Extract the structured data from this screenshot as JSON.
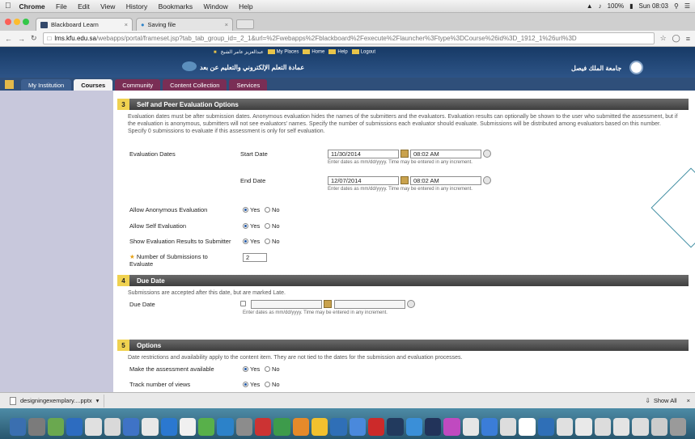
{
  "macos": {
    "app_name": "Chrome",
    "menus": [
      "File",
      "Edit",
      "View",
      "History",
      "Bookmarks",
      "Window",
      "Help"
    ],
    "battery": "100%",
    "clock": "Sun 08:03"
  },
  "browser": {
    "tabs": [
      {
        "label": "Blackboard Learn",
        "active": true
      },
      {
        "label": "Saving file",
        "active": false
      }
    ],
    "url_host": "lms.kfu.edu.sa",
    "url_path": "/webapps/portal/frameset.jsp?tab_tab_group_id=_2_1&url=%2Fwebapps%2Fblackboard%2Fexecute%2Flauncher%3Ftype%3DCourse%26id%3D_1912_1%26url%3D"
  },
  "bb": {
    "user_name": "عبدالعزيز عامر الشيخ",
    "top_links": [
      "My Places",
      "Home",
      "Help",
      "Logout"
    ],
    "deanship_title": "عمادة التعلم الإلكتروني والتعليم عن بعد",
    "university_title": "جامعة الملك فيصل",
    "nav_tabs": [
      {
        "label": "My Institution",
        "active": false
      },
      {
        "label": "Courses",
        "active": true
      },
      {
        "label": "Community",
        "active": false
      },
      {
        "label": "Content Collection",
        "active": false
      },
      {
        "label": "Services",
        "active": false
      }
    ]
  },
  "section3": {
    "number": "3",
    "title": "Self and Peer Evaluation Options",
    "description": "Evaluation dates must be after submission dates. Anonymous evaluation hides the names of the submitters and the evaluators. Evaluation results can optionally be shown to the user who submitted the assessment, but if the evaluation is anonymous, submitters will not see evaluators' names. Specify the number of submissions each evaluator should evaluate. Submissions will be distributed among evaluators based on this number. Specify 0 submissions to evaluate if this assessment is only for self evaluation.",
    "eval_dates_label": "Evaluation Dates",
    "start_label": "Start Date",
    "start_date": "11/30/2014",
    "start_time": "08:02 AM",
    "end_label": "End Date",
    "end_date": "12/07/2014",
    "end_time": "08:02 AM",
    "date_hint": "Enter dates as mm/dd/yyyy. Time may be entered in any increment.",
    "anon_label": "Allow Anonymous Evaluation",
    "self_label": "Allow Self Evaluation",
    "show_label": "Show Evaluation Results to Submitter",
    "yes": "Yes",
    "no": "No",
    "num_label": "Number of Submissions to Evaluate",
    "num_value": "2"
  },
  "section4": {
    "number": "4",
    "title": "Due Date",
    "description": "Submissions are accepted after this date, but are marked Late.",
    "due_label": "Due Date",
    "date_hint": "Enter dates as mm/dd/yyyy. Time may be entered in any increment."
  },
  "section5": {
    "number": "5",
    "title": "Options",
    "description": "Date restrictions and availability apply to the content item. They are not tied to the dates for the submission and evaluation processes.",
    "available_label": "Make the assessment available",
    "track_label": "Track number of views",
    "yes": "Yes",
    "no": "No"
  },
  "downloads": {
    "file": "designingexemplary....pptx",
    "show_all": "Show All"
  },
  "colors": {
    "header_blue": "#173a66",
    "nav_tab_maroon": "#7a2e55",
    "section_header": "#4a4a4a",
    "section_number": "#f0d250",
    "sidebar": "#c8c8dc"
  },
  "dock_colors": [
    "#3a6fb0",
    "#7b7b7b",
    "#6aa84f",
    "#2d6cc0",
    "#e0e0e0",
    "#d9d9d9",
    "#3f73c6",
    "#e8e8e8",
    "#2b78d0",
    "#f0f0f0",
    "#58b04a",
    "#2c82c9",
    "#8c8c8c",
    "#cc3333",
    "#3d9b4b",
    "#e58a2a",
    "#f2c12e",
    "#2f6fb7",
    "#4a89dc",
    "#cc2a2a",
    "#223a5e",
    "#3a8fd8",
    "#22335a",
    "#c04ac0",
    "#e6e6e6",
    "#3b7dd8",
    "#dddddd",
    "#ffffff",
    "#2f6fb7",
    "#e0e0e0",
    "#e9e9e9",
    "#dcdcdc",
    "#e4e4e4",
    "#dddddd",
    "#cccccc",
    "#9a9a9a"
  ]
}
